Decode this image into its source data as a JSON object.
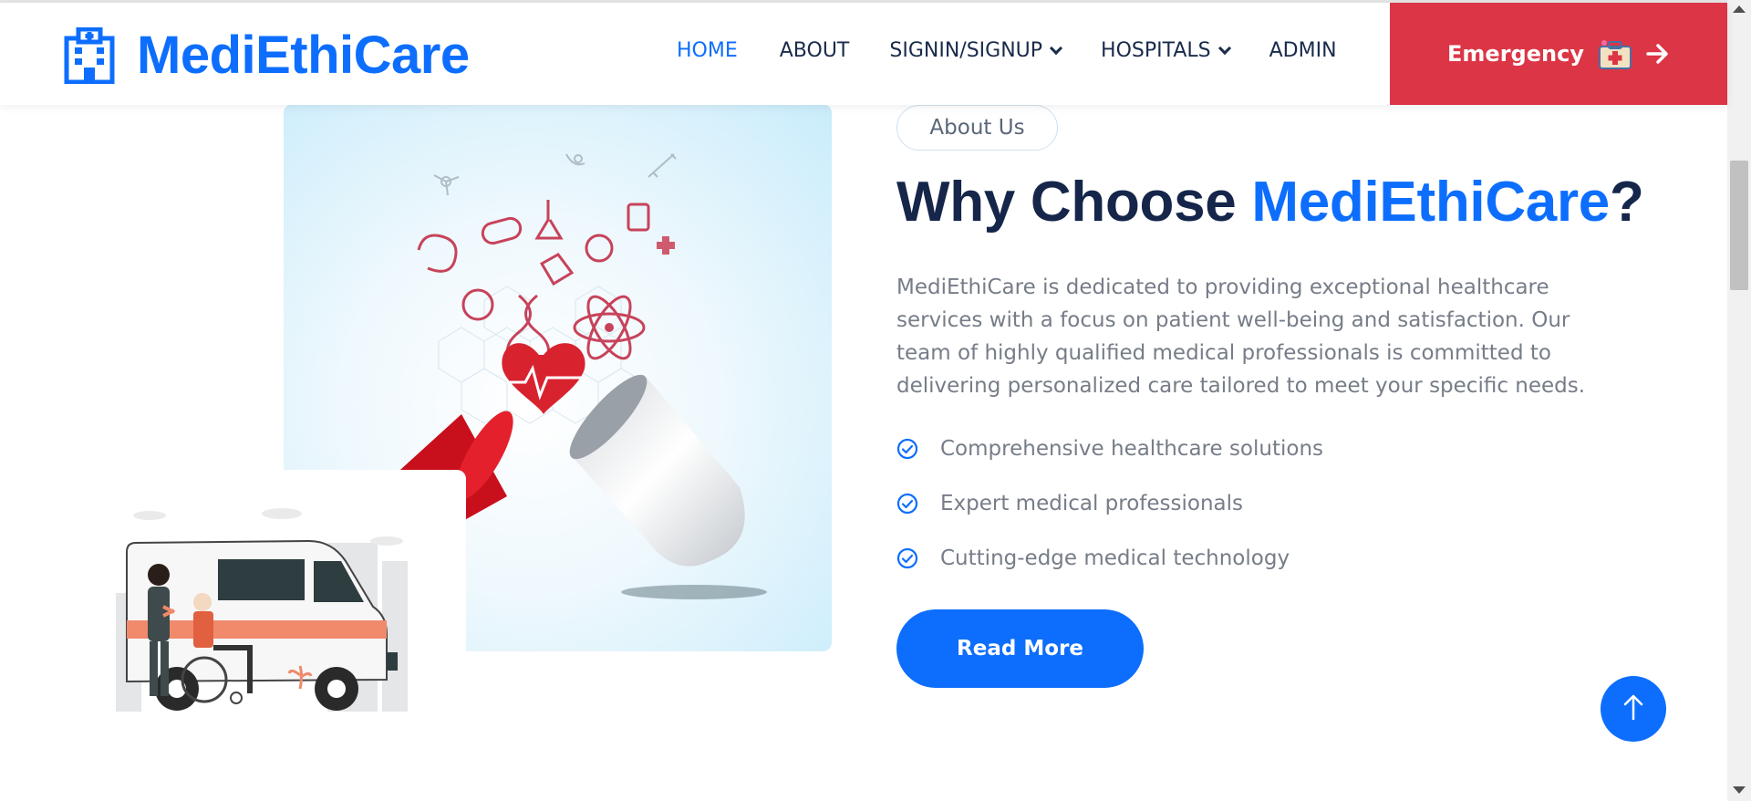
{
  "brand": {
    "name": "MediEthiCare",
    "icon": "hospital-building-icon"
  },
  "nav": {
    "home": "HOME",
    "about": "ABOUT",
    "signin": "SIGNIN/SIGNUP",
    "hospitals": "HOSPITALS",
    "admin": "ADMIN"
  },
  "emergency": {
    "label": "Emergency",
    "icon": "first-aid-kit-icon",
    "arrow": "arrow-right-icon"
  },
  "about": {
    "pill": "About Us",
    "headline_prefix": "Why Choose ",
    "headline_accent": "MediEthiCare",
    "headline_suffix": "?",
    "description": "MediEthiCare is dedicated to providing exceptional healthcare services with a focus on patient well-being and satisfaction. Our team of highly qualified medical professionals is committed to delivering personalized care tailored to meet your specific needs.",
    "features": [
      "Comprehensive healthcare solutions",
      "Expert medical professionals",
      "Cutting-edge medical technology"
    ],
    "cta": "Read More"
  },
  "colors": {
    "primary": "#0d6efd",
    "danger": "#dc3545",
    "heading": "#15264a",
    "body": "#767d88"
  },
  "back_to_top": {
    "icon": "arrow-up-icon"
  }
}
